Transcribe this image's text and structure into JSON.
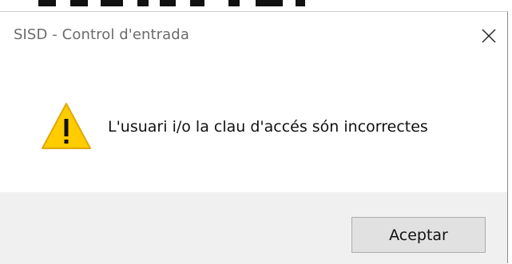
{
  "window": {
    "title": "SISD - Control d'entrada",
    "close_icon": "close-icon"
  },
  "content": {
    "icon": "warning-icon",
    "icon_color": "#FFCC00",
    "message": "L'usuari i/o la clau d'accés són incorrectes"
  },
  "footer": {
    "ok_label": "Aceptar"
  }
}
